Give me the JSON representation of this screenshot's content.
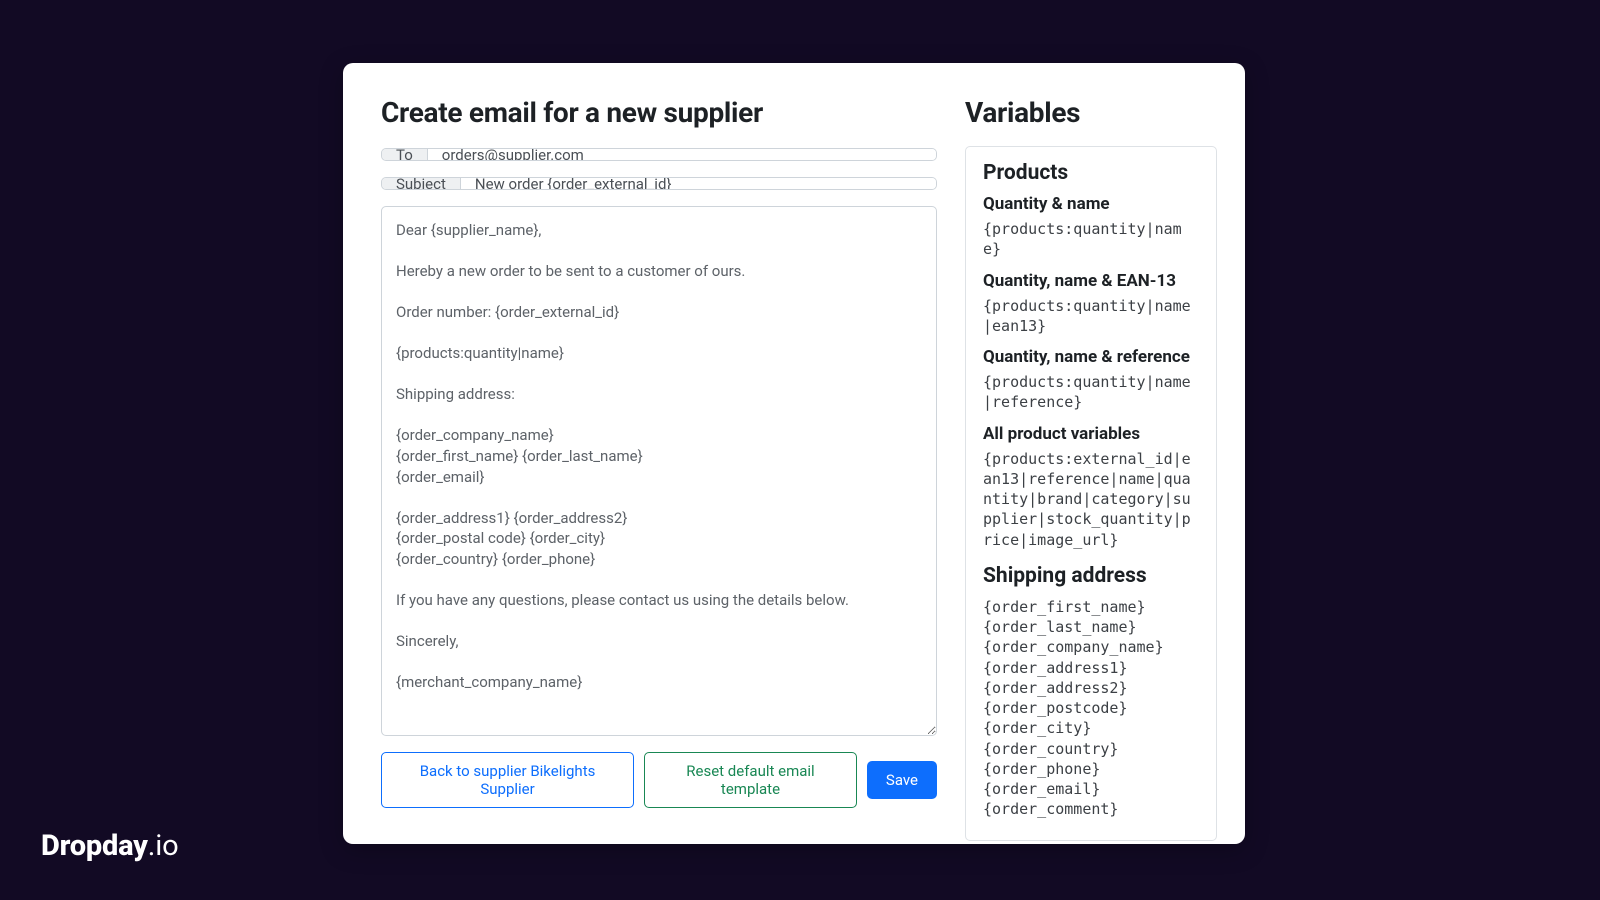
{
  "brand": {
    "bold": "Dropday",
    "light": ".io"
  },
  "form": {
    "title": "Create email for a new supplier",
    "to_label": "To",
    "to_value": "orders@supplier.com",
    "subject_label": "Subject",
    "subject_value": "New order {order_external_id}",
    "body_value": "Dear {supplier_name},\n\nHereby a new order to be sent to a customer of ours.\n\nOrder number: {order_external_id}\n\n{products:quantity|name}\n\nShipping address:\n\n{order_company_name}\n{order_first_name} {order_last_name}\n{order_email}\n\n{order_address1} {order_address2}\n{order_postal code} {order_city}\n{order_country} {order_phone}\n\nIf you have any questions, please contact us using the details below.\n\nSincerely,\n\n{merchant_company_name}"
  },
  "buttons": {
    "back": "Back to supplier Bikelights Supplier",
    "reset": "Reset default email template",
    "save": "Save"
  },
  "variables": {
    "title": "Variables",
    "products_heading": "Products",
    "items": [
      {
        "label": "Quantity & name",
        "code": "{products:quantity|name}"
      },
      {
        "label": "Quantity, name & EAN-13",
        "code": "{products:quantity|name|ean13}"
      },
      {
        "label": "Quantity, name & reference",
        "code": "{products:quantity|name|reference}"
      },
      {
        "label": "All product variables",
        "code": "{products:external_id|ean13|reference|name|quantity|brand|category|supplier|stock_quantity|price|image_url}"
      }
    ],
    "shipping_heading": "Shipping address",
    "shipping_vars": [
      "{order_first_name}",
      "{order_last_name}",
      "{order_company_name}",
      "{order_address1}",
      "{order_address2}",
      "{order_postcode}",
      "{order_city}",
      "{order_country}",
      "{order_phone}",
      "{order_email}",
      "{order_comment}"
    ]
  }
}
